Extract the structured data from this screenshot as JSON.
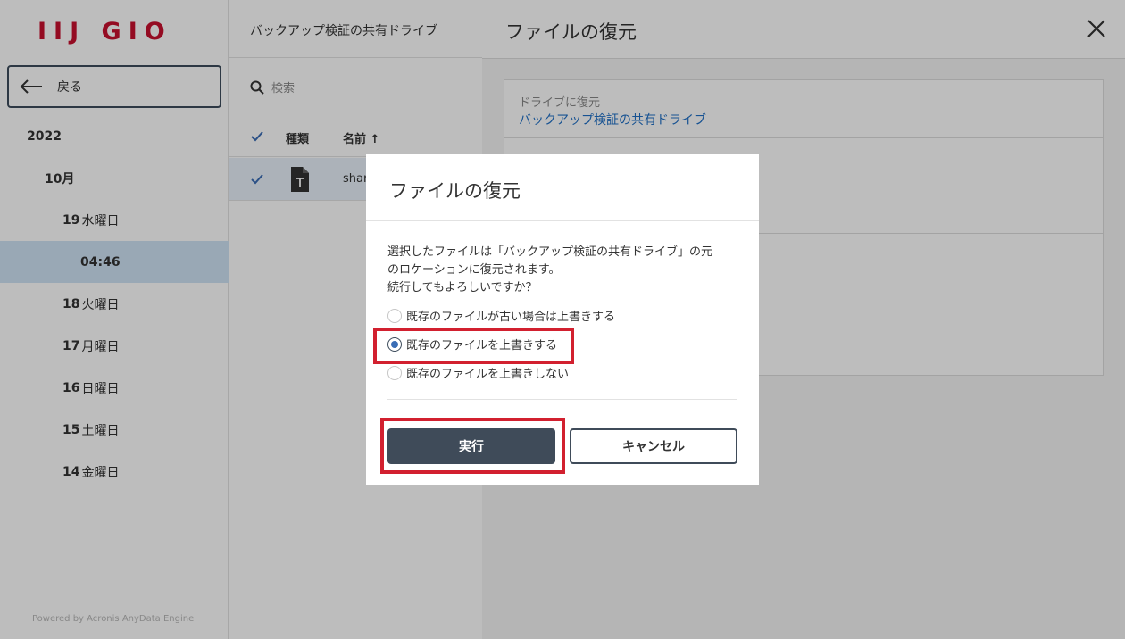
{
  "logo": {
    "text": "IIJ GIO"
  },
  "sidebar": {
    "back_label": "戻る",
    "year": "2022",
    "month": "10月",
    "days": [
      {
        "num": "19",
        "label": "水曜日"
      },
      {
        "num": "18",
        "label": "火曜日"
      },
      {
        "num": "17",
        "label": "月曜日"
      },
      {
        "num": "16",
        "label": "日曜日"
      },
      {
        "num": "15",
        "label": "土曜日"
      },
      {
        "num": "14",
        "label": "金曜日"
      }
    ],
    "selected_time": "04:46",
    "powered_by": "Powered by Acronis AnyData Engine"
  },
  "middle": {
    "drive_title": "バックアップ検証の共有ドライブ",
    "search_placeholder": "検索",
    "columns": {
      "type": "種類",
      "name": "名前 ↑"
    },
    "row_name": "shar"
  },
  "panel": {
    "title": "ファイルの復元",
    "restore_to_label": "ドライブに復元",
    "restore_to_value": "バックアップ検証の共有ドライブ"
  },
  "modal": {
    "title": "ファイルの復元",
    "message_lines": [
      "選択したファイルは「バックアップ検証の共有ドライブ」の元",
      "のロケーションに復元されます。",
      "続行してもよろしいですか？"
    ],
    "options": [
      {
        "label": "既存のファイルが古い場合は上書きする",
        "selected": false
      },
      {
        "label": "既存のファイルを上書きする",
        "selected": true
      },
      {
        "label": "既存のファイルを上書きしない",
        "selected": false
      }
    ],
    "run_label": "実行",
    "cancel_label": "キャンセル"
  },
  "colors": {
    "logo": "#c8102e",
    "primary_button": "#3f4b59",
    "link": "#1f6fc5",
    "annotation": "#d2202f"
  }
}
